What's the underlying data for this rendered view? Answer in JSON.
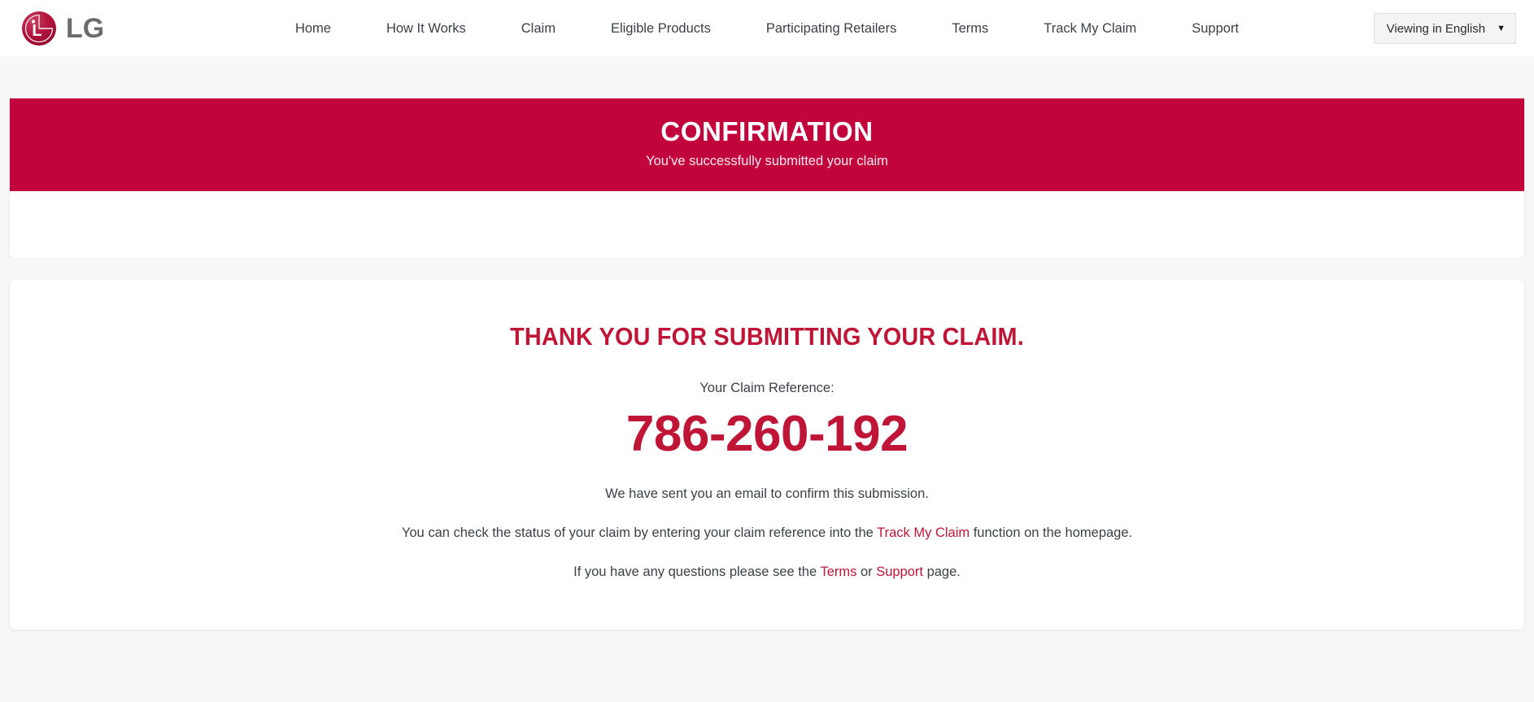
{
  "header": {
    "brand": {
      "logo_icon": "lg-logo-icon",
      "wordmark": "LG"
    },
    "nav": [
      {
        "label": "Home"
      },
      {
        "label": "How It Works"
      },
      {
        "label": "Claim"
      },
      {
        "label": "Eligible Products"
      },
      {
        "label": "Participating Retailers"
      },
      {
        "label": "Terms"
      },
      {
        "label": "Track My Claim"
      },
      {
        "label": "Support"
      }
    ],
    "language_selector": {
      "value": "Viewing in English",
      "caret": "▼"
    }
  },
  "banner": {
    "title": "CONFIRMATION",
    "subtitle": "You've successfully submitted your claim",
    "background_color": "#c2043c"
  },
  "main": {
    "heading": "THANK YOU FOR SUBMITTING YOUR CLAIM.",
    "reference_label": "Your Claim Reference:",
    "reference_number": "786-260-192",
    "email_note": "We have sent you an email to confirm this submission.",
    "status_line": {
      "before": "You can check the status of your claim by entering your claim reference into the ",
      "link": "Track My Claim",
      "after": " function on the homepage."
    },
    "questions_line": {
      "before": "If you have any questions please see the ",
      "link_terms": "Terms",
      "middle": " or ",
      "link_support": "Support",
      "after": " page."
    },
    "accent_color": "#bf1637"
  }
}
